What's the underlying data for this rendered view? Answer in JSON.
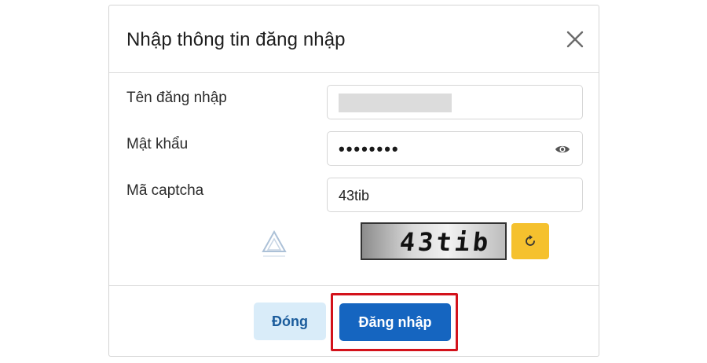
{
  "dialog": {
    "title": "Nhập thông tin đăng nhập",
    "close_icon": "close-icon"
  },
  "form": {
    "username": {
      "label": "Tên đăng nhập",
      "value": ""
    },
    "password": {
      "label": "Mật khẩu",
      "value": "••••••••",
      "toggle_icon": "eye-icon"
    },
    "captcha": {
      "label": "Mã captcha",
      "value": "43tib",
      "image_text": "43tib",
      "refresh_icon": "refresh-icon"
    }
  },
  "footer": {
    "close_label": "Đóng",
    "login_label": "Đăng nhập"
  },
  "colors": {
    "primary": "#1565c0",
    "secondary_bg": "#d9ecf9",
    "refresh_bg": "#f5c12e",
    "highlight": "#d3121b"
  }
}
